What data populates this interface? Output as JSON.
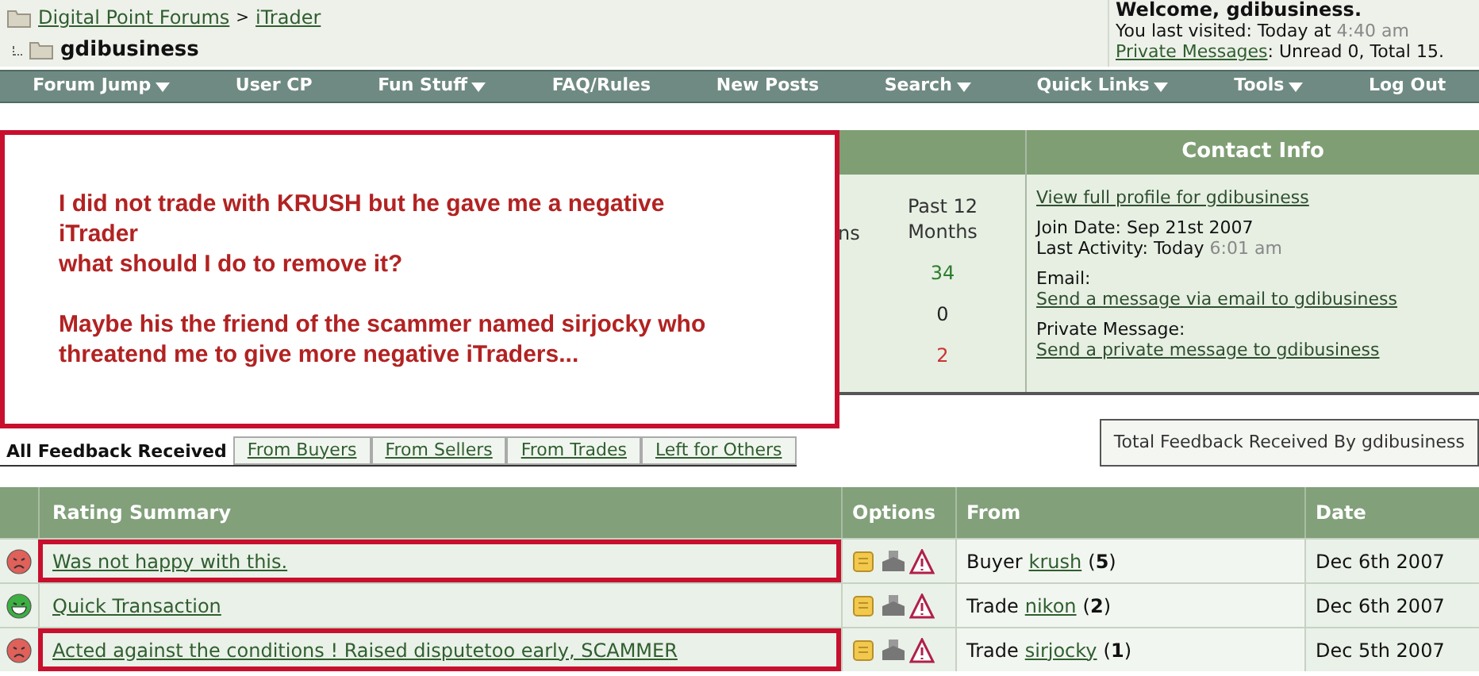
{
  "breadcrumb": {
    "links": [
      "Digital Point Forums",
      "iTrader"
    ],
    "separator": ">",
    "current": "gdibusiness"
  },
  "welcome": {
    "title": "Welcome, gdibusiness.",
    "last_visited_label": "You last visited: Today at",
    "last_visited_time": "4:40 am",
    "pm_link": "Private Messages",
    "pm_text": ": Unread 0, Total 15."
  },
  "nav": [
    {
      "label": "Forum Jump",
      "dropdown": true
    },
    {
      "label": "User CP",
      "dropdown": false
    },
    {
      "label": "Fun Stuff",
      "dropdown": true
    },
    {
      "label": "FAQ/Rules",
      "dropdown": false
    },
    {
      "label": "New Posts",
      "dropdown": false
    },
    {
      "label": "Search",
      "dropdown": true
    },
    {
      "label": "Quick Links",
      "dropdown": true
    },
    {
      "label": "Tools",
      "dropdown": true
    },
    {
      "label": "Log Out",
      "dropdown": false
    }
  ],
  "stats": {
    "column_2": "ns",
    "header": "Past 12 Months",
    "values": [
      {
        "value": "34",
        "color": "#2e7d2e"
      },
      {
        "value": "0",
        "color": "#222222"
      },
      {
        "value": "2",
        "color": "#cc3333"
      }
    ]
  },
  "contact": {
    "title": "Contact Info",
    "profile_link": "View full profile for gdibusiness",
    "join_date": "Join Date: Sep 21st 2007",
    "last_activity_label": "Last Activity: Today",
    "last_activity_time": "6:01 am",
    "email_label": "Email:",
    "email_link": "Send a message via email to gdibusiness",
    "pm_label": "Private Message:",
    "pm_link": "Send a private message to gdibusiness"
  },
  "annotation": {
    "paragraphs": [
      [
        "I did not trade with KRUSH but he gave me a negative",
        "iTrader",
        "what should I do to remove it?"
      ],
      [
        "Maybe his the friend of the scammer named sirjocky who",
        "threatend me to give more negative iTraders..."
      ]
    ]
  },
  "tabs": [
    {
      "label": "All Feedback Received",
      "selected": true
    },
    {
      "label": "From Buyers",
      "selected": false
    },
    {
      "label": "From Sellers",
      "selected": false
    },
    {
      "label": "From Trades",
      "selected": false
    },
    {
      "label": "Left for Others",
      "selected": false
    }
  ],
  "total_box": "Total Feedback Received By gdibusiness",
  "table": {
    "columns": [
      "Rating Summary",
      "Options",
      "From",
      "Date"
    ],
    "rows": [
      {
        "kind": "negative",
        "summary": "Was not happy with this.",
        "highlighted": true,
        "role": "Buyer",
        "user": "krush",
        "count": "(**5**)",
        "date": "Dec 6th 2007"
      },
      {
        "kind": "positive",
        "summary": "Quick Transaction",
        "highlighted": false,
        "role": "Trade",
        "user": "nikon",
        "count": "(**2**)",
        "date": "Dec 6th 2007"
      },
      {
        "kind": "negative",
        "summary": "Acted against the conditions ! Raised disputetoo early, SCAMMER",
        "highlighted": true,
        "role": "Trade",
        "user": "sirjocky",
        "count": "(**1**)",
        "date": "Dec 5th 2007"
      }
    ]
  }
}
